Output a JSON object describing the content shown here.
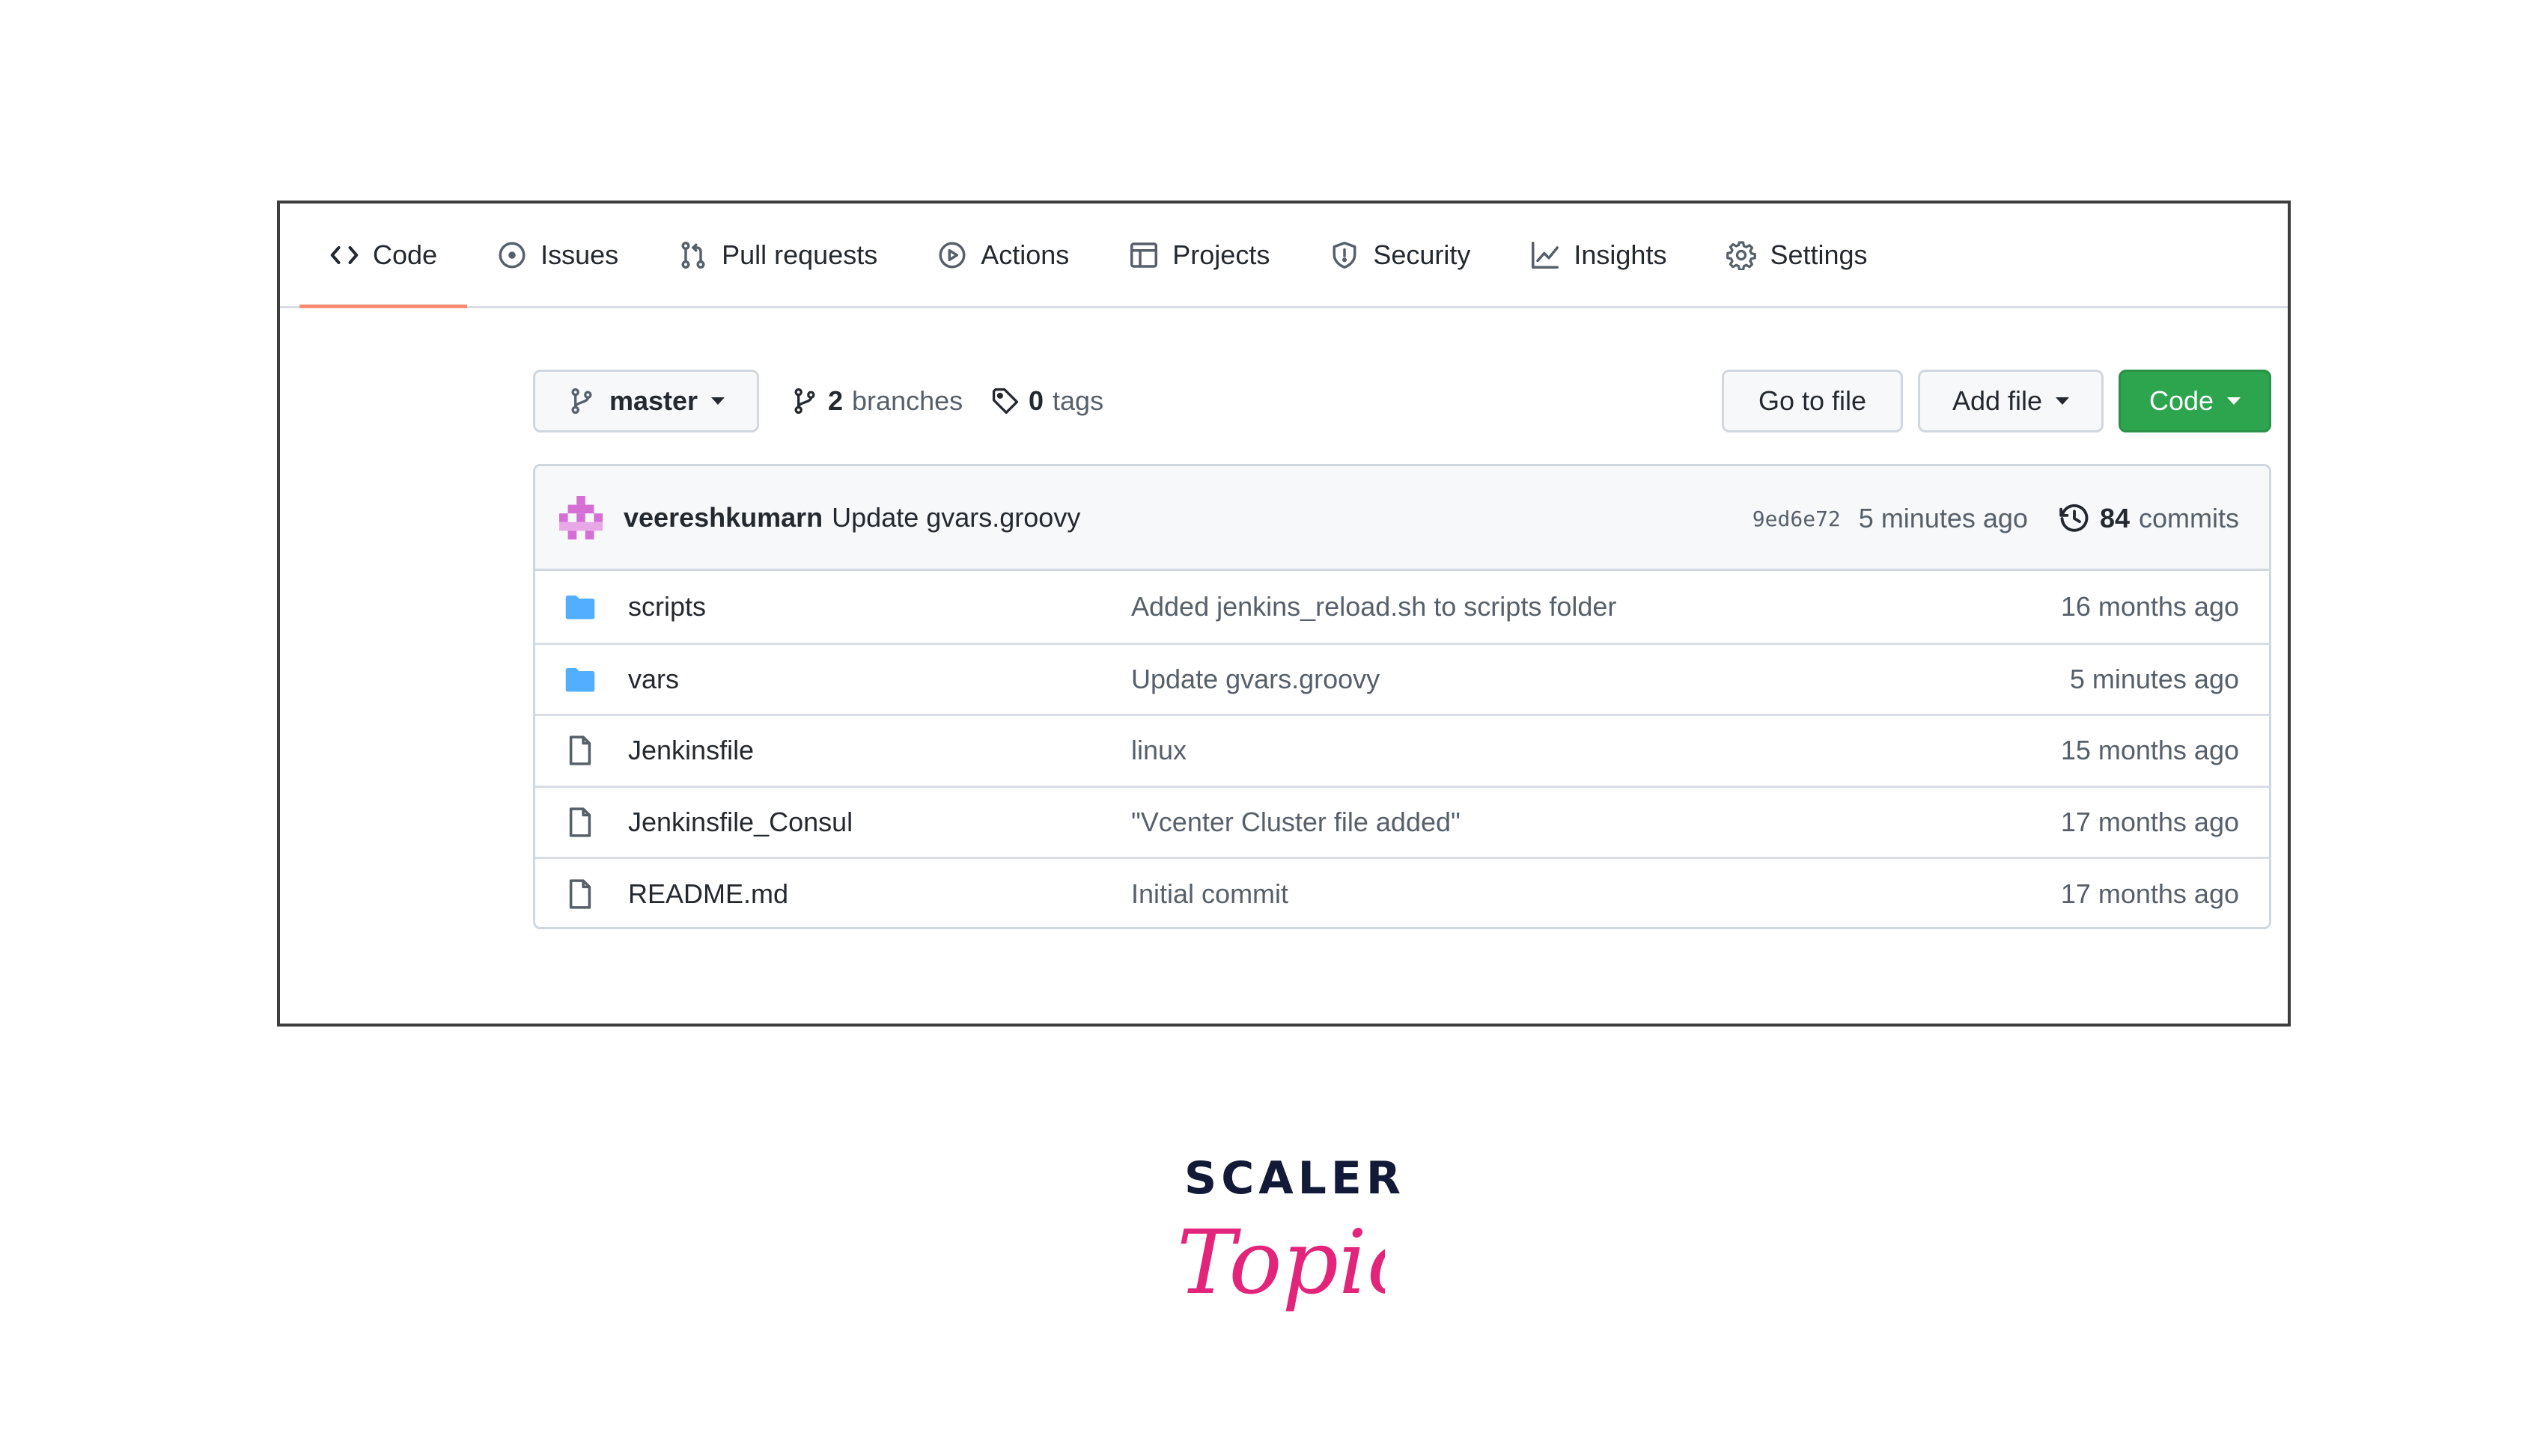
{
  "tabs": [
    {
      "label": "Code",
      "icon": "code-icon",
      "active": true
    },
    {
      "label": "Issues",
      "icon": "issue-icon"
    },
    {
      "label": "Pull requests",
      "icon": "pull-request-icon"
    },
    {
      "label": "Actions",
      "icon": "play-icon"
    },
    {
      "label": "Projects",
      "icon": "table-icon"
    },
    {
      "label": "Security",
      "icon": "shield-icon"
    },
    {
      "label": "Insights",
      "icon": "graph-icon"
    },
    {
      "label": "Settings",
      "icon": "gear-icon"
    }
  ],
  "toolbar": {
    "branch": "master",
    "branches_count": "2",
    "branches_label": "branches",
    "tags_count": "0",
    "tags_label": "tags",
    "go_to_file": "Go to file",
    "add_file": "Add file",
    "code": "Code"
  },
  "latest_commit": {
    "author": "veereshkumarn",
    "message": "Update gvars.groovy",
    "sha": "9ed6e72",
    "age": "5 minutes ago",
    "commits_count": "84",
    "commits_label": "commits"
  },
  "files": [
    {
      "type": "folder",
      "name": "scripts",
      "message": "Added jenkins_reload.sh to scripts folder",
      "age": "16 months ago"
    },
    {
      "type": "folder",
      "name": "vars",
      "message": "Update gvars.groovy",
      "age": "5 minutes ago"
    },
    {
      "type": "file",
      "name": "Jenkinsfile",
      "message": "linux",
      "age": "15 months ago"
    },
    {
      "type": "file",
      "name": "Jenkinsfile_Consul",
      "message": "\"Vcenter Cluster file added\"",
      "age": "17 months ago"
    },
    {
      "type": "file",
      "name": "README.md",
      "message": "Initial commit",
      "age": "17 months ago"
    }
  ],
  "brand": {
    "word": "SCALER",
    "script": "Topics",
    "colors": {
      "word": "#121a38",
      "script": "#e2257a"
    }
  },
  "colors": {
    "folder": "#54aeff",
    "primary_button": "#2da44e",
    "active_tab_underline": "#fd8c73",
    "avatar": "#d56fd5"
  }
}
